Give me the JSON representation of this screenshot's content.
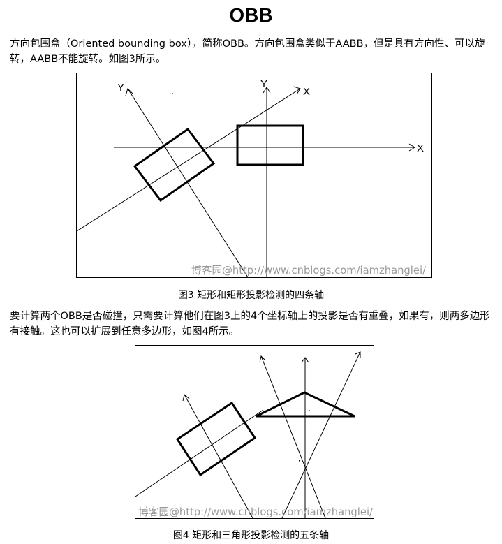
{
  "article": {
    "title": "OBB",
    "paragraph1": "方向包围盒（Oriented bounding box），简称OBB。方向包围盒类似于AABB，但是具有方向性、可以旋转，AABB不能旋转。如图3所示。",
    "paragraph2": "要计算两个OBB是否碰撞，只需要计算他们在图3上的4个坐标轴上的投影是否有重叠，如果有，则两多边形有接触。这也可以扩展到任意多边形，如图4所示。"
  },
  "figure3": {
    "caption": "图3 矩形和矩形投影检测的四条轴",
    "axis_labels": {
      "y_rotated": "Y",
      "y_aligned": "Y",
      "x_rotated": "X",
      "x_aligned": "X"
    },
    "watermark": "博客园@http://www.cnblogs.com/iamzhanglei/"
  },
  "figure4": {
    "caption": "图4 矩形和三角形投影检测的五条轴",
    "watermark": "博客园@http://www.cnblogs.com/iamzhanglei/"
  }
}
